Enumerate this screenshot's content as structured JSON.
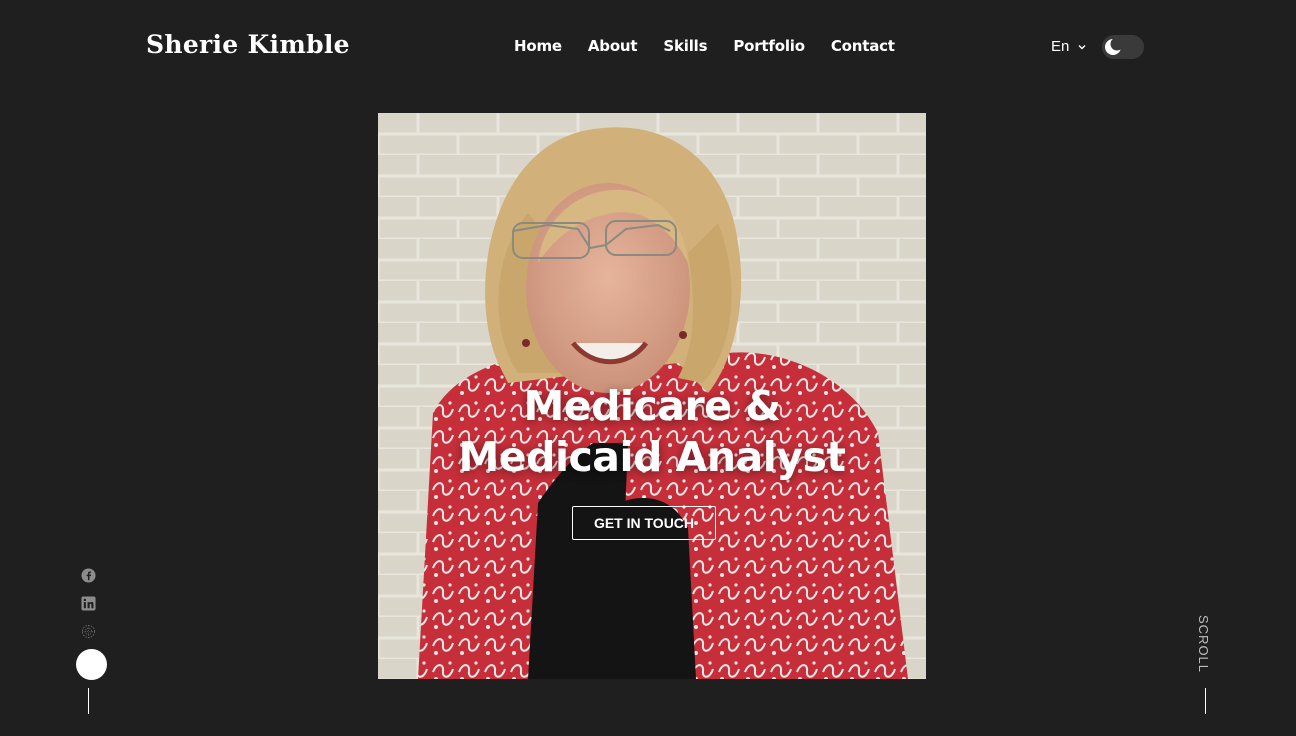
{
  "brand": {
    "name": "Sherie Kimble"
  },
  "nav": {
    "items": [
      "Home",
      "About",
      "Skills",
      "Portfolio",
      "Contact"
    ]
  },
  "header": {
    "language": "En",
    "theme_toggle_icon": "moon-icon"
  },
  "hero": {
    "headline_line1": "Medicare &",
    "headline_line2": "Medicaid Analyst",
    "cta_label": "GET IN TOUCH",
    "image_subject": "portrait-photo"
  },
  "socials": [
    "facebook-icon",
    "linkedin-icon",
    "globe-icon"
  ],
  "scroll_label": "SCROLL",
  "colors": {
    "background": "#1f1f1f",
    "text": "#ffffff",
    "jacket_red": "#c62f3a"
  }
}
